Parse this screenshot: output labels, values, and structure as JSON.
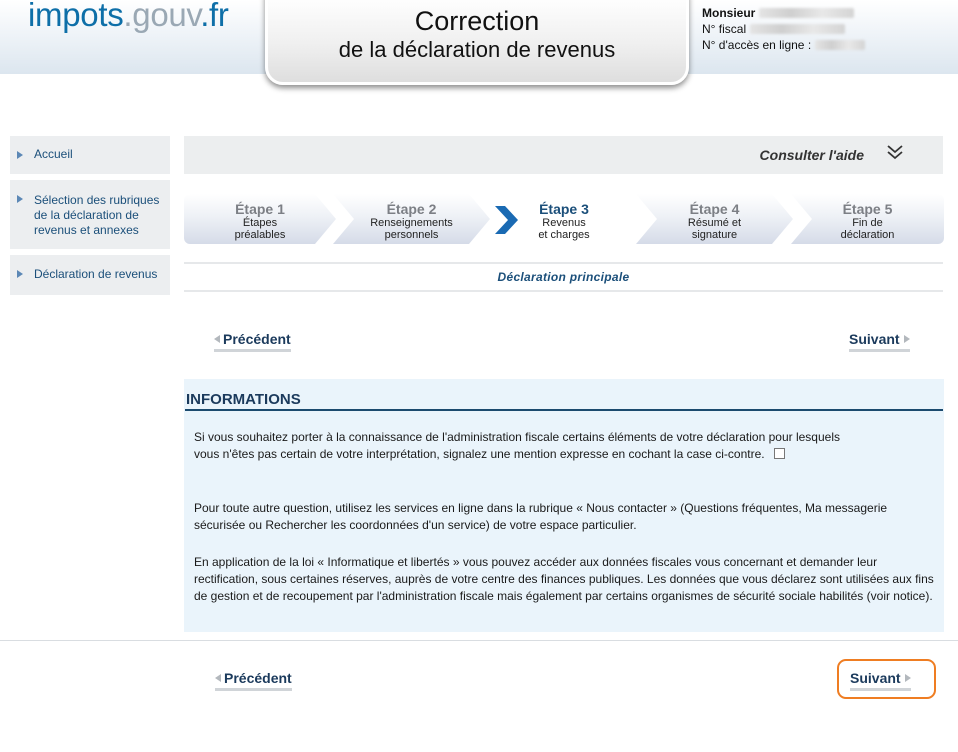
{
  "header": {
    "logo": {
      "part1": "impots",
      "part2": ".gouv",
      "part3": ".fr"
    },
    "title_line1": "Correction",
    "title_line2": "de la déclaration de revenus",
    "user": {
      "salutation": "Monsieur",
      "fiscal_label": "N° fiscal",
      "access_label": "N° d'accès en ligne :"
    }
  },
  "sidebar": {
    "items": [
      {
        "label": "Accueil"
      },
      {
        "label": "Sélection des rubriques de la déclaration de revenus et annexes"
      },
      {
        "label": "Déclaration de revenus"
      }
    ]
  },
  "help": {
    "label": "Consulter l'aide"
  },
  "steps": [
    {
      "title": "Étape 1",
      "line1": "Étapes",
      "line2": "préalables"
    },
    {
      "title": "Étape 2",
      "line1": "Renseignements",
      "line2": "personnels"
    },
    {
      "title": "Étape 3",
      "line1": "Revenus",
      "line2": "et charges"
    },
    {
      "title": "Étape 4",
      "line1": "Résumé et",
      "line2": "signature"
    },
    {
      "title": "Étape 5",
      "line1": "Fin de",
      "line2": "déclaration"
    }
  ],
  "active_step": 3,
  "section_label": "Déclaration principale",
  "nav": {
    "previous": "Précédent",
    "next": "Suivant"
  },
  "info": {
    "title": "INFORMATIONS",
    "p1": "Si vous souhaitez porter à la connaissance de l'administration fiscale certains éléments de votre déclaration pour lesquels vous n'êtes pas certain de votre interprétation, signalez une mention expresse en cochant la case ci-contre.",
    "p2": "Pour toute autre question, utilisez les services en ligne dans la rubrique « Nous contacter » (Questions fréquentes, Ma messagerie sécurisée ou Rechercher les coordonnées d'un service) de votre espace particulier.",
    "p3": "En application de la loi « Informatique et libertés » vous pouvez accéder aux données fiscales vous concernant et demander leur rectification, sous certaines réserves, auprès de votre centre des finances publiques. Les données que vous déclarez sont utilisées aux fins de gestion et de recoupement par l'administration fiscale mais également par certains organismes de sécurité sociale habilités (voir notice)."
  },
  "colors": {
    "brand_blue": "#0e6fa8",
    "link_blue": "#1b4f7a",
    "info_bg": "#eaf4fb",
    "focus_orange": "#ef7d22"
  },
  "icons": {
    "help_toggle": "double-chevron-down-icon",
    "active_step": "chevron-right-icon",
    "sidebar_bullet": "triangle-right-icon"
  }
}
